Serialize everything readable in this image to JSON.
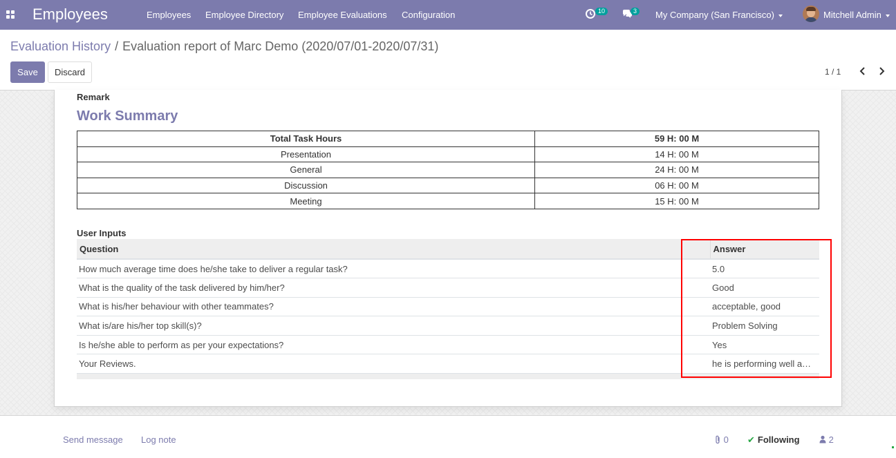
{
  "navbar": {
    "app_title": "Employees",
    "menu": [
      "Employees",
      "Employee Directory",
      "Employee Evaluations",
      "Configuration"
    ],
    "activity_count": "10",
    "message_count": "3",
    "company": "My Company (San Francisco)",
    "user": "Mitchell Admin",
    "accent_color": "#7c7bad"
  },
  "breadcrumb": {
    "parent": "Evaluation History",
    "separator": "/",
    "current": "Evaluation report of Marc Demo (2020/07/01-2020/07/31)"
  },
  "buttons": {
    "save": "Save",
    "discard": "Discard"
  },
  "pager": {
    "text": "1 / 1"
  },
  "form": {
    "remark_label": "Remark",
    "work_summary_title": "Work Summary",
    "summary_rows": [
      {
        "label": "Total Task Hours",
        "value": "59 H: 00 M"
      },
      {
        "label": "Presentation",
        "value": "14 H: 00 M"
      },
      {
        "label": "General",
        "value": "24 H: 00 M"
      },
      {
        "label": "Discussion",
        "value": "06 H: 00 M"
      },
      {
        "label": "Meeting",
        "value": "15 H: 00 M"
      }
    ],
    "user_inputs_label": "User Inputs",
    "inputs_headers": {
      "question": "Question",
      "answer": "Answer"
    },
    "inputs_rows": [
      {
        "question": "How much average time does he/she take to deliver a regular task?",
        "answer": "5.0"
      },
      {
        "question": "What is the quality of the task delivered by him/her?",
        "answer": "Good"
      },
      {
        "question": "What is his/her behaviour with other teammates?",
        "answer": "acceptable, good"
      },
      {
        "question": "What is/are his/her top skill(s)?",
        "answer": "Problem Solving"
      },
      {
        "question": "Is he/she able to perform as per your expectations?",
        "answer": "Yes"
      },
      {
        "question": "Your Reviews.",
        "answer": "he is performing well a…"
      }
    ]
  },
  "chatter": {
    "send_message": "Send message",
    "log_note": "Log note",
    "attachments": "0",
    "following": "Following",
    "followers": "2"
  }
}
